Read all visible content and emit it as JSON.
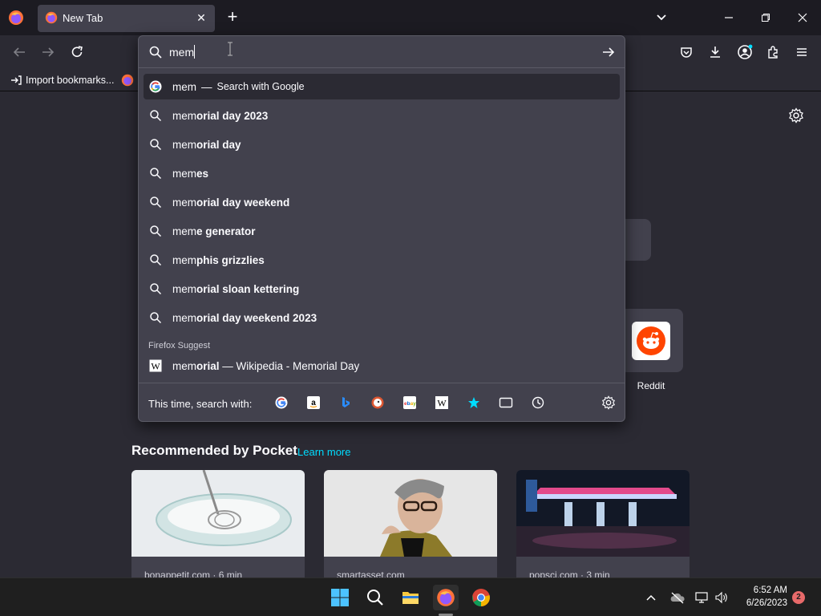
{
  "window": {
    "tab_title": "New Tab",
    "tab_close_glyph": "✕",
    "new_tab_glyph": "+"
  },
  "bookmarks": {
    "import_label": "Import bookmarks..."
  },
  "urlbar": {
    "value": "mem",
    "heuristic": {
      "typed": "mem",
      "separator": "—",
      "action": "Search with Google"
    },
    "suggestions": [
      {
        "typed": "mem",
        "completion": "orial day 2023"
      },
      {
        "typed": "mem",
        "completion": "orial day"
      },
      {
        "typed": "mem",
        "completion": "es"
      },
      {
        "typed": "mem",
        "completion": "orial day weekend"
      },
      {
        "typed": "mem",
        "completion": "e generator"
      },
      {
        "typed": "mem",
        "completion": "phis grizzlies"
      },
      {
        "typed": "mem",
        "completion": "orial sloan kettering"
      },
      {
        "typed": "mem",
        "completion": "orial day weekend 2023"
      }
    ],
    "firefox_suggest_label": "Firefox Suggest",
    "wiki_result": {
      "typed": "mem",
      "completion": "orial",
      "rest": " — Wikipedia - Memorial Day"
    },
    "oneoff_label": "This time, search with:"
  },
  "newtab": {
    "reddit_label": "Reddit",
    "pocket_title": "Recommended by Pocket",
    "pocket_learn_more": "Learn more",
    "cards": [
      {
        "source": "bonappetit.com · 6 min"
      },
      {
        "source": "smartasset.com"
      },
      {
        "source": "popsci.com · 3 min"
      }
    ]
  },
  "taskbar": {
    "time": "6:52 AM",
    "date": "6/26/2023",
    "notification_count": "2"
  },
  "colors": {
    "accent": "#00ddff",
    "panel": "#42414d",
    "toolbar": "#2b2a33"
  }
}
